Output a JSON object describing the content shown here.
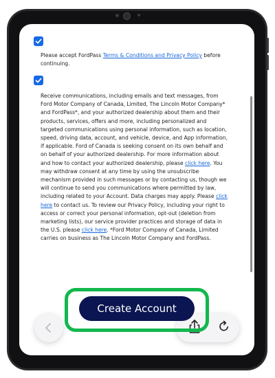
{
  "consent_1": {
    "checked": true,
    "text_before": "Please accept FordPass ",
    "link": "Terms & Conditions and Privacy Policy",
    "text_after": " before continuing."
  },
  "consent_2": {
    "checked": true,
    "p1": "Receive communications, including emails and text messages, from Ford Motor Company of Canada, Limited, The Lincoln Motor Company* and FordPass*, and your authorized dealership about them and their products, services, offers and more, including personalized and targeted communications using personal information, such as location, speed, driving data, account, and vehicle, device, and App information, if applicable. Ford of Canada is seeking consent on its own behalf and on behalf of your authorized dealership. For more information about and how to contact your authorized dealership, please ",
    "link1": "click here",
    "p2": ". You may withdraw consent at any time by using the unsubscribe mechanism provided in such messages or by contacting us, though we will continue to send you communications where permitted by law, including related to your Account. Data charges may apply. Please ",
    "link2": "click here",
    "p3": " to contact us. To review our Privacy Policy, including your right to access or correct your personal information, opt-out (deletion from marketing lists), our service provider practices and storage of data in the U.S. please ",
    "link3": "click here",
    "p4": ". *Ford Motor Company of Canada, Limited carries on business as The Lincoln Motor Company and FordPass."
  },
  "create_account_label": "Create Account",
  "colors": {
    "accent": "#1769e6",
    "button": "#0b1551",
    "highlight": "#12b84e"
  },
  "icons": [
    "checkmark-icon",
    "chevron-left-icon",
    "share-icon",
    "reload-icon"
  ]
}
